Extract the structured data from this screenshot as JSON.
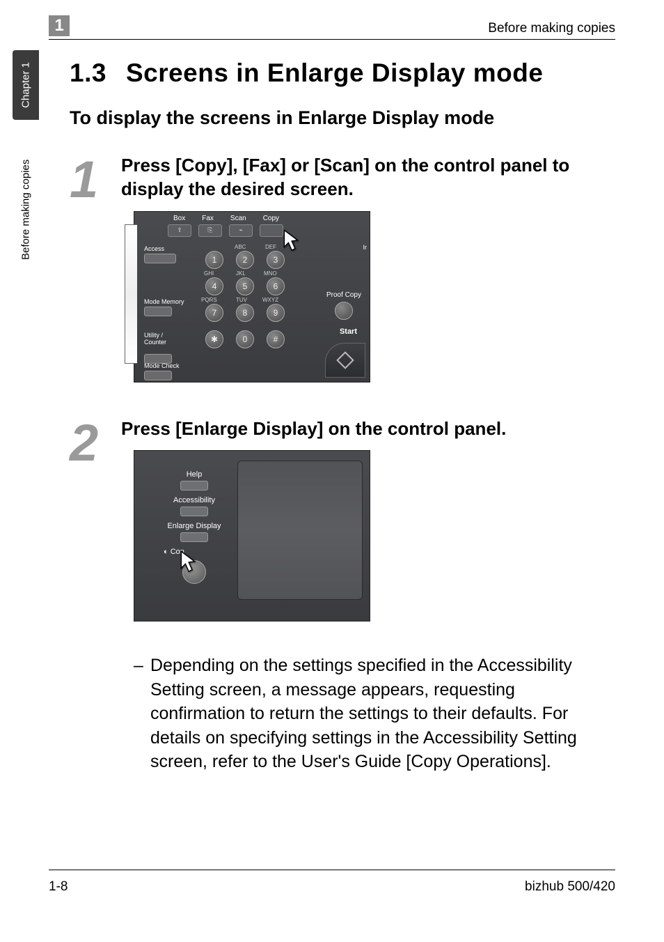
{
  "side": {
    "chapter": "Chapter 1",
    "title": "Before making copies"
  },
  "header": {
    "chapter_num": "1",
    "running": "Before making copies"
  },
  "section": {
    "num": "1.3",
    "title": "Screens in Enlarge Display mode"
  },
  "subtitle": "To display the screens in Enlarge Display mode",
  "steps": {
    "s1": {
      "num": "1",
      "text": "Press [Copy], [Fax] or [Scan] on the control panel to display the desired screen."
    },
    "s2": {
      "num": "2",
      "text": "Press [Enlarge Display] on the control panel."
    }
  },
  "panel1": {
    "tabs": {
      "box": "Box",
      "fax": "Fax",
      "scan": "Scan",
      "copy": "Copy"
    },
    "alpha": {
      "abc": "ABC",
      "def": "DEF",
      "ghi": "GHI",
      "jkl": "JKL",
      "mno": "MNO",
      "pqrs": "PQRS",
      "tuv": "TUV",
      "wxyz": "WXYZ"
    },
    "keys": {
      "k1": "1",
      "k2": "2",
      "k3": "3",
      "k4": "4",
      "k5": "5",
      "k6": "6",
      "k7": "7",
      "k8": "8",
      "k9": "9",
      "kstar": "✱",
      "k0": "0",
      "khash": "#"
    },
    "labels": {
      "access": "Access",
      "mode_memory": "Mode Memory",
      "utility": "Utility /\nCounter",
      "mode_check": "Mode Check",
      "proof": "Proof Copy",
      "start": "Start",
      "ir": "Ir"
    }
  },
  "panel2": {
    "help": "Help",
    "accessibility": "Accessibility",
    "enlarge": "Enlarge Display",
    "contrast": "Con"
  },
  "note": "Depending on the settings specified in the Accessibility Setting screen, a message appears, requesting confirmation to return the settings to their defaults. For details on specifying settings in the Accessibility Setting screen, refer to the User's Guide [Copy Operations].",
  "footer": {
    "page": "1-8",
    "product": "bizhub 500/420"
  }
}
